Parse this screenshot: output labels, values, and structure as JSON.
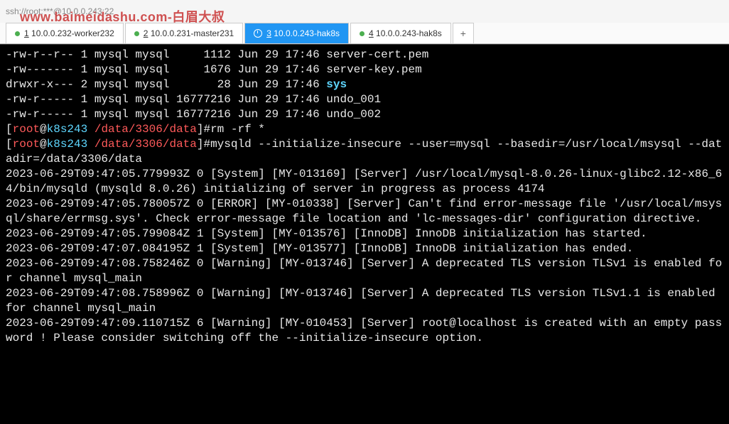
{
  "titlebar": {
    "title": "ssh://root:***@10.0.0.243:22"
  },
  "watermark": {
    "text_en": "www.baimeidashu.com",
    "text_cn": "-白眉大叔"
  },
  "tabs": [
    {
      "num": "1",
      "label": "10.0.0.232-worker232"
    },
    {
      "num": "2",
      "label": "10.0.0.231-master231"
    },
    {
      "num": "3",
      "label": "10.0.0.243-hak8s"
    },
    {
      "num": "4",
      "label": "10.0.0.243-hak8s"
    }
  ],
  "add_tab": "+",
  "lines": {
    "l0": "-rw-r--r-- 1 mysql mysql     1112 Jun 29 17:46 server-cert.pem",
    "l1": "-rw------- 1 mysql mysql     1676 Jun 29 17:46 server-key.pem",
    "l2a": "drwxr-x--- 2 mysql mysql       28 Jun 29 17:46 ",
    "l2b": "sys",
    "l3": "-rw-r----- 1 mysql mysql 16777216 Jun 29 17:46 undo_001",
    "l4": "-rw-r----- 1 mysql mysql 16777216 Jun 29 17:46 undo_002"
  },
  "prompt1": {
    "bracket_open": "[",
    "user": "root",
    "at": "@",
    "host": "k8s243",
    "sep": " ",
    "path": "/data/3306/data",
    "bracket_close": "]#",
    "cmd": "rm -rf *"
  },
  "prompt2": {
    "bracket_open": "[",
    "user": "root",
    "at": "@",
    "host": "k8s243",
    "sep": " ",
    "path": "/data/3306/data",
    "bracket_close": "]#",
    "cmd": "mysqld --initialize-insecure --user=mysql --basedir=/usr/local/msysql --datadir=/data/3306/data"
  },
  "log": {
    "m0": "2023-06-29T09:47:05.779993Z 0 [System] [MY-013169] [Server] /usr/local/mysql-8.0.26-linux-glibc2.12-x86_64/bin/mysqld (mysqld 8.0.26) initializing of server in progress as process 4174",
    "m1": "2023-06-29T09:47:05.780057Z 0 [ERROR] [MY-010338] [Server] Can't find error-message file '/usr/local/msysql/share/errmsg.sys'. Check error-message file location and 'lc-messages-dir' configuration directive.",
    "m2": "2023-06-29T09:47:05.799084Z 1 [System] [MY-013576] [InnoDB] InnoDB initialization has started.",
    "m3": "2023-06-29T09:47:07.084195Z 1 [System] [MY-013577] [InnoDB] InnoDB initialization has ended.",
    "m4": "2023-06-29T09:47:08.758246Z 0 [Warning] [MY-013746] [Server] A deprecated TLS version TLSv1 is enabled for channel mysql_main",
    "m5": "2023-06-29T09:47:08.758996Z 0 [Warning] [MY-013746] [Server] A deprecated TLS version TLSv1.1 is enabled for channel mysql_main",
    "m6": "2023-06-29T09:47:09.110715Z 6 [Warning] [MY-010453] [Server] root@localhost is created with an empty password ! Please consider switching off the --initialize-insecure option."
  }
}
